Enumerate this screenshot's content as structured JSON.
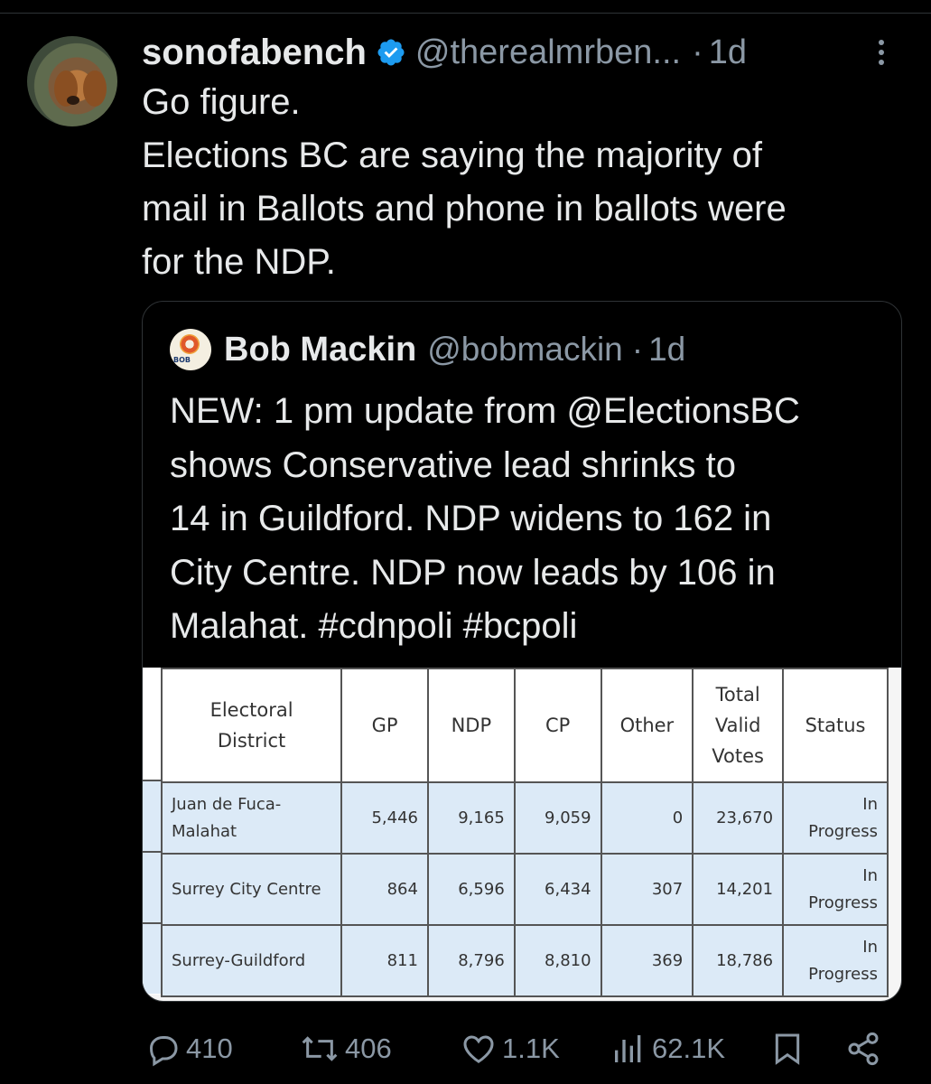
{
  "post": {
    "display_name": "sonofabench",
    "handle": "@therealmrben...",
    "dot": "·",
    "time": "1d",
    "text_lines": [
      "Go figure.",
      "Elections BC are saying the majority of",
      "mail in Ballots and phone in ballots were",
      "for the NDP."
    ]
  },
  "quote": {
    "display_name": "Bob Mackin",
    "handle": "@bobmackin",
    "dot": "·",
    "time": "1d",
    "avatar_text": "BOB",
    "text_lines": [
      "NEW: 1 pm update from @ElectionsBC",
      "shows Conservative lead shrinks to",
      "14 in Guildford. NDP widens to 162 in",
      "City Centre. NDP now leads by 106 in",
      "Malahat. #cdnpoli #bcpoli"
    ],
    "table": {
      "headers": [
        [
          "Electoral",
          "District"
        ],
        [
          "GP"
        ],
        [
          "NDP"
        ],
        [
          "CP"
        ],
        [
          "Other"
        ],
        [
          "Total",
          "Valid",
          "Votes"
        ],
        [
          "Status"
        ]
      ],
      "rows": [
        {
          "district": [
            "Juan de Fuca-",
            "Malahat"
          ],
          "gp": "5,446",
          "ndp": "9,165",
          "cp": "9,059",
          "other": "0",
          "total": "23,670",
          "status": [
            "In",
            "Progress"
          ]
        },
        {
          "district": [
            "Surrey City Centre"
          ],
          "gp": "864",
          "ndp": "6,596",
          "cp": "6,434",
          "other": "307",
          "total": "14,201",
          "status": [
            "In",
            "Progress"
          ]
        },
        {
          "district": [
            "Surrey-Guildford"
          ],
          "gp": "811",
          "ndp": "8,796",
          "cp": "8,810",
          "other": "369",
          "total": "18,786",
          "status": [
            "In",
            "Progress"
          ]
        }
      ]
    }
  },
  "actions": {
    "replies": "410",
    "reposts": "406",
    "likes": "1.1K",
    "views": "62.1K"
  },
  "icons": {
    "verified": "verified-badge-icon",
    "more": "more-options-icon",
    "reply": "reply-icon",
    "repost": "repost-icon",
    "like": "heart-icon",
    "views": "views-icon",
    "bookmark": "bookmark-icon",
    "share": "share-icon"
  },
  "colors": {
    "background": "#000000",
    "text": "#e7e9ea",
    "secondary": "#8b98a5",
    "verified": "#1d9bf0",
    "table_row": "#dceaf7"
  }
}
